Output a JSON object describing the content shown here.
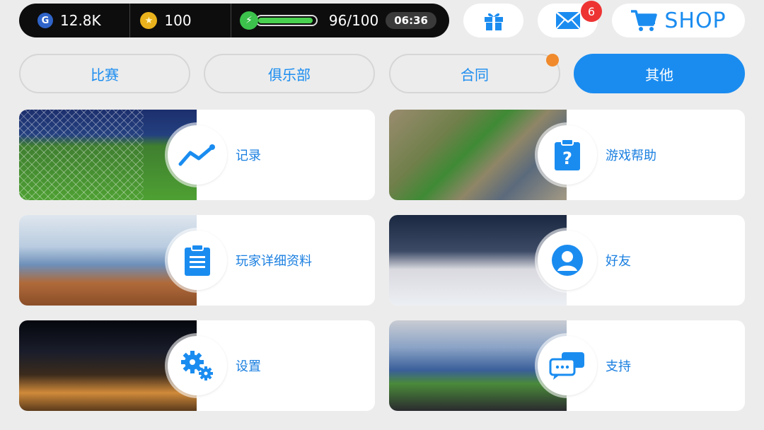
{
  "status": {
    "g_icon_letter": "G",
    "g_value": "12.8K",
    "coin_value": "100",
    "energy_text": "96/100",
    "energy_fraction": 0.96,
    "timer": "06:36"
  },
  "header": {
    "mail_badge": "6",
    "shop_label": "SHOP"
  },
  "tabs": [
    {
      "label": "比赛"
    },
    {
      "label": "俱乐部"
    },
    {
      "label": "合同"
    },
    {
      "label": "其他"
    }
  ],
  "cards": [
    {
      "label": "记录",
      "icon": "chart-trend-icon"
    },
    {
      "label": "游戏帮助",
      "icon": "help-clipboard-icon"
    },
    {
      "label": "玩家详细资料",
      "icon": "document-icon"
    },
    {
      "label": "好友",
      "icon": "person-icon"
    },
    {
      "label": "设置",
      "icon": "gears-icon"
    },
    {
      "label": "支持",
      "icon": "chat-bubbles-icon"
    }
  ],
  "colors": {
    "accent": "#1a8cf0",
    "badge": "#e33333",
    "notify_dot": "#f08a2c",
    "energy": "#49d24f"
  }
}
